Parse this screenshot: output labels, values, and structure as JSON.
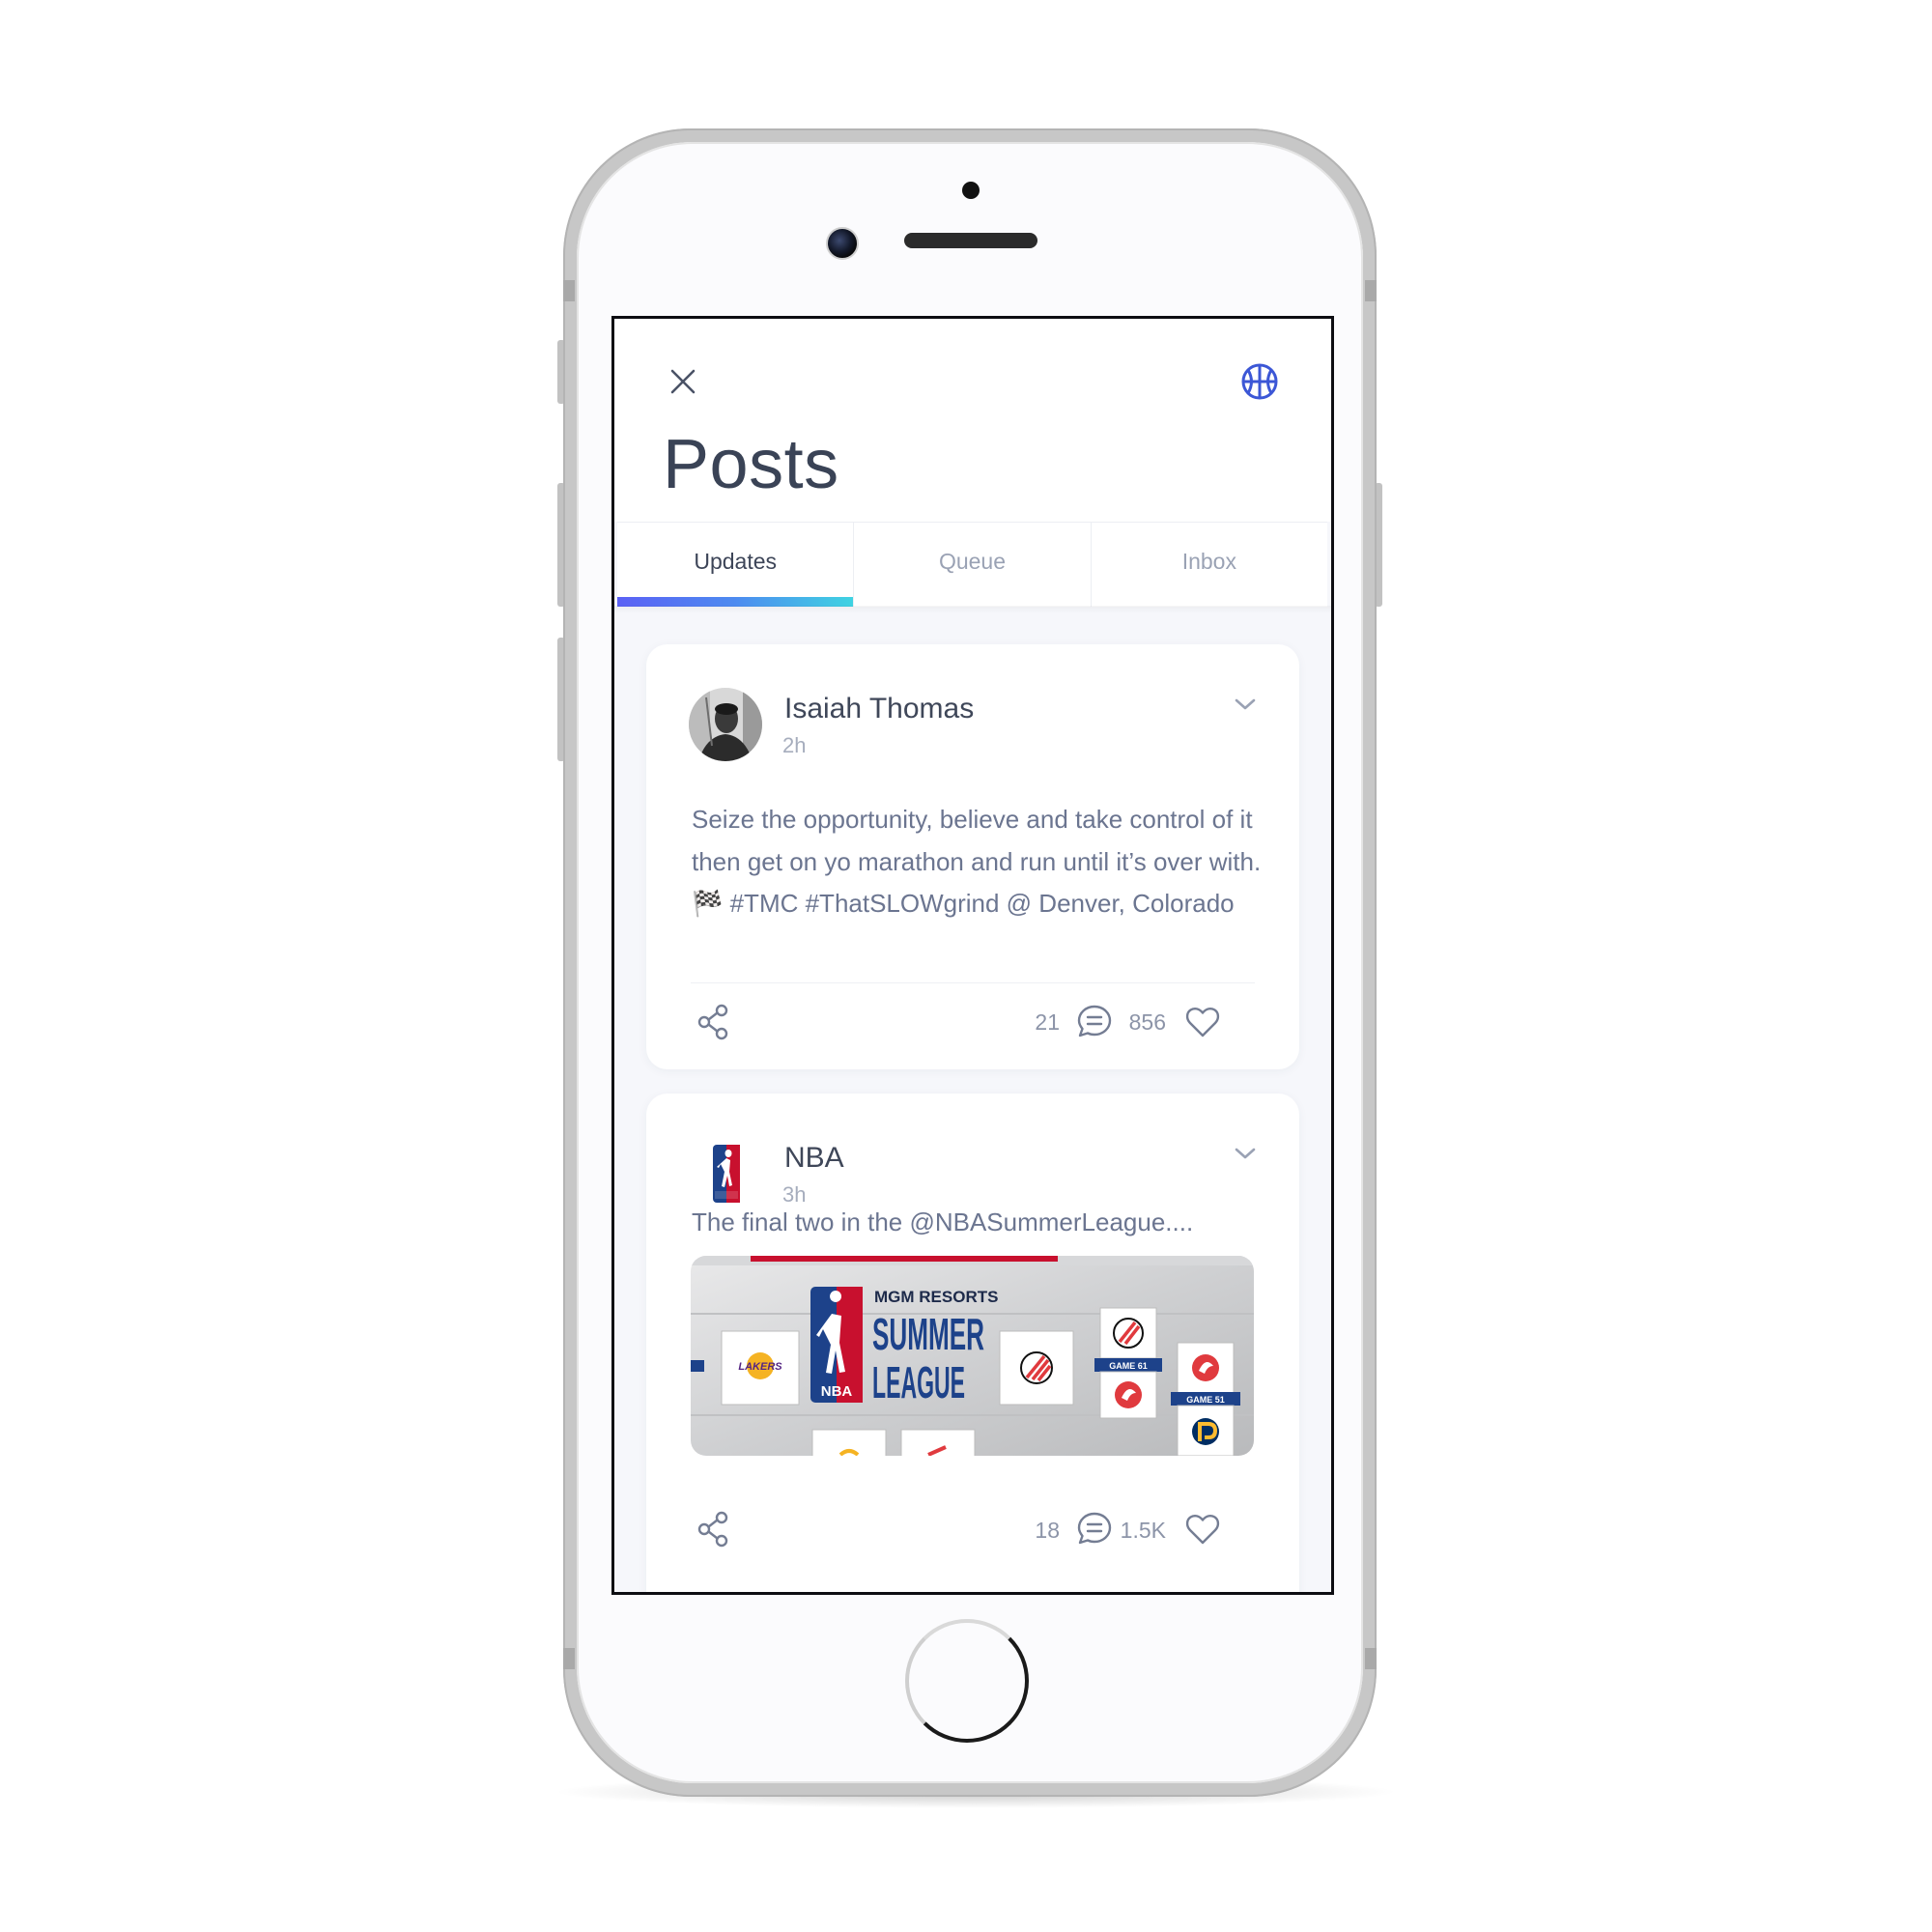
{
  "screen": {
    "title": "Posts",
    "tabs": [
      {
        "label": "Updates",
        "active": true
      },
      {
        "label": "Queue",
        "active": false
      },
      {
        "label": "Inbox",
        "active": false
      }
    ],
    "icons": {
      "close": "close-icon",
      "app": "basketball-icon"
    },
    "accent_gradient": [
      "#5b61f5",
      "#4d8bf0",
      "#3fd3e2"
    ]
  },
  "posts": [
    {
      "author": "Isaiah Thomas",
      "time": "2h",
      "text": "Seize the opportunity, believe and take control of it then get on yo marathon and run until it’s over with. 🏁 #TMC #ThatSLOWgrind @ Denver, Colorado",
      "comments": "21",
      "likes": "856"
    },
    {
      "author": "NBA",
      "time": "3h",
      "text": "The final two in the @NBASummerLeague....",
      "image": {
        "line1": "MGM RESORTS",
        "line2": "SUMMER",
        "line3": "LEAGUE",
        "logo_text": "NBA",
        "team_label": "LAKERS",
        "game_a": "GAME 61",
        "game_b": "GAME 51"
      },
      "comments": "18",
      "likes": "1.5K"
    }
  ]
}
